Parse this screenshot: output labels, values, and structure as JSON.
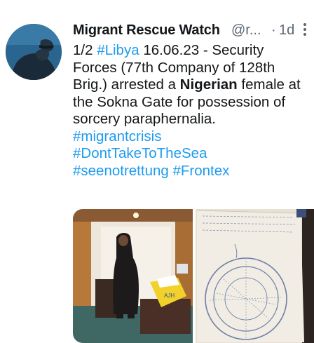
{
  "tweet": {
    "author_name": "Migrant Rescue Watch",
    "author_handle": "@r...",
    "separator": "·",
    "time": "1d",
    "text_lines": [
      [
        {
          "t": "1/2 "
        },
        {
          "t": "#Libya",
          "tag": true
        },
        {
          "t": " 16.06.23 - Security"
        }
      ],
      [
        {
          "t": "Forces (77th Company of 128th"
        }
      ],
      [
        {
          "t": "Brig.) arrested a "
        },
        {
          "t": "Nigerian",
          "bold": true
        },
        {
          "t": " female at"
        }
      ],
      [
        {
          "t": "the Sokna Gate for possession of"
        }
      ],
      [
        {
          "t": "sorcery paraphernalia."
        }
      ],
      [
        {
          "t": "#migrantcrisis",
          "tag": true
        }
      ],
      [
        {
          "t": "#DontTakeToTheSea",
          "tag": true
        }
      ],
      [
        {
          "t": "#seenotrettung",
          "tag": true
        },
        {
          "t": " "
        },
        {
          "t": "#Frontex",
          "tag": true
        }
      ]
    ]
  },
  "icons": {
    "more": "more-vertical-icon",
    "avatar": "profile-avatar"
  },
  "colors": {
    "link": "#1d9bf0",
    "text": "#14171a",
    "secondary": "#5b6670"
  }
}
